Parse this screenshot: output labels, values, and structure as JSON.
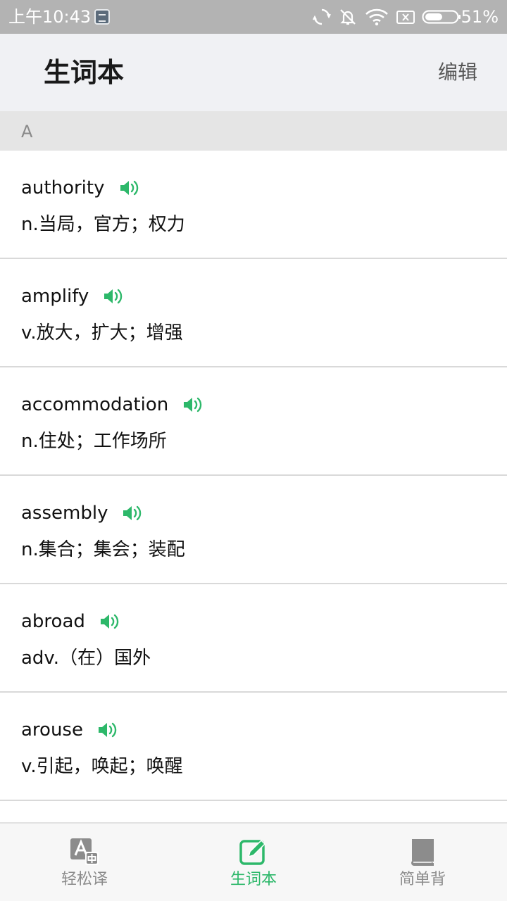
{
  "status_bar": {
    "time": "上午10:43",
    "battery": "51%",
    "icons": [
      "notification-icon",
      "sync-icon",
      "mute-icon",
      "wifi-icon",
      "no-sim-icon",
      "battery-icon"
    ]
  },
  "header": {
    "title": "生词本",
    "edit_label": "编辑"
  },
  "section": {
    "letter": "A"
  },
  "words": [
    {
      "word": "authority",
      "meaning": "n.当局，官方；权力"
    },
    {
      "word": "amplify",
      "meaning": "v.放大，扩大；增强"
    },
    {
      "word": "accommodation",
      "meaning": "n.住处；工作场所"
    },
    {
      "word": "assembly",
      "meaning": "n.集合；集会；装配"
    },
    {
      "word": "abroad",
      "meaning": "adv.（在）国外"
    },
    {
      "word": "arouse",
      "meaning": "v.引起，唤起；唤醒"
    }
  ],
  "nav": {
    "items": [
      {
        "label": "轻松译",
        "icon": "translate-icon",
        "active": false
      },
      {
        "label": "生词本",
        "icon": "edit-note-icon",
        "active": true
      },
      {
        "label": "简单背",
        "icon": "book-icon",
        "active": false
      }
    ]
  },
  "colors": {
    "accent": "#2db86a",
    "status_bar": "#b3b3b3",
    "header_bg": "#f0f1f4",
    "section_bg": "#e5e5e5"
  }
}
